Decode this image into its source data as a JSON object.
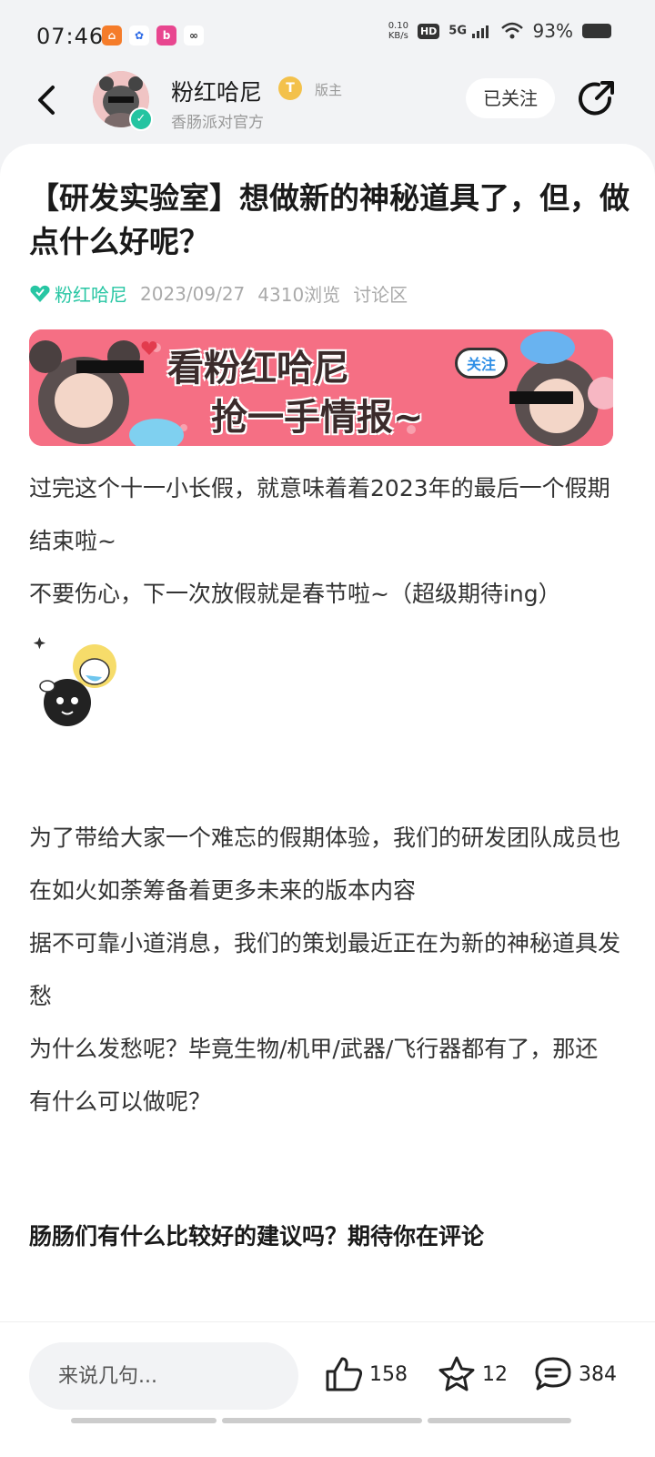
{
  "status_bar": {
    "time": "07:46",
    "net_speed_value": "0.10",
    "net_speed_unit": "KB/s",
    "hd": "HD",
    "signal": "5G",
    "battery": "93%"
  },
  "header": {
    "author_name": "粉红哈尼",
    "level_badge": "T",
    "role_label": "版主",
    "author_subtitle": "香肠派对官方",
    "follow_label": "已关注"
  },
  "post": {
    "title": "【研发实验室】想做新的神秘道具了，但，做点什么好呢？",
    "author_tag": "粉红哈尼",
    "date": "2023/09/27",
    "views": "4310浏览",
    "section": "讨论区",
    "banner": {
      "line1": "看粉红哈尼",
      "line2": "抢一手情报~",
      "follow_badge": "关注"
    },
    "paragraphs": [
      "过完这个十一小长假，就意味着着2023年的最后一个假期结束啦~",
      "不要伤心，下一次放假就是春节啦~（超级期待ing）"
    ],
    "paragraphs2": [
      "为了带给大家一个难忘的假期体验，我们的研发团队成员也在如火如荼筹备着更多未来的版本内容",
      "据不可靠小道消息，我们的策划最近正在为新的神秘道具发愁",
      "为什么发愁呢？毕竟生物/机甲/武器/飞行器都有了，那还有什么可以做呢？"
    ],
    "bold_line": "肠肠们有什么比较好的建议吗？期待你在评论"
  },
  "bottom_bar": {
    "comment_placeholder": "来说几句...",
    "likes": "158",
    "favorites": "12",
    "comments": "384"
  },
  "colors": {
    "accent": "#27c6a3",
    "banner_bg": "#f56f84",
    "background": "#f2f3f5"
  }
}
